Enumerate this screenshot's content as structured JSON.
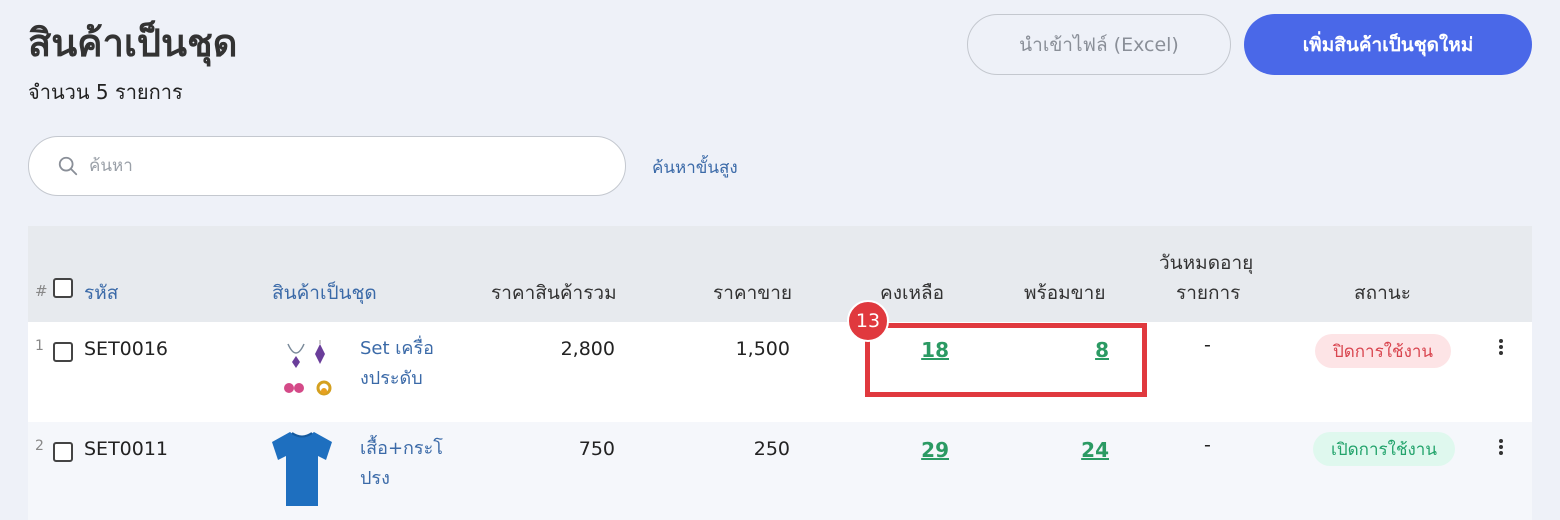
{
  "header": {
    "title": "สินค้าเป็นชุด",
    "count_text": "จำนวน 5 รายการ",
    "import_button": "นำเข้าไฟล์ (Excel)",
    "add_button": "เพิ่มสินค้าเป็นชุดใหม่"
  },
  "search": {
    "placeholder": "ค้นหา",
    "advanced_label": "ค้นหาขั้นสูง"
  },
  "table": {
    "columns": {
      "hash": "#",
      "code": "รหัส",
      "product": "สินค้าเป็นชุด",
      "total_price": "ราคาสินค้ารวม",
      "sell_price": "ราคาขาย",
      "remaining": "คงเหลือ",
      "ready": "พร้อมขาย",
      "expiry_line1": "วันหมดอายุ",
      "expiry_line2": "รายการ",
      "status": "สถานะ"
    },
    "rows": [
      {
        "num": "1",
        "code": "SET0016",
        "name_line1": "Set เครื่อ",
        "name_line2": "งประดับ",
        "total_price": "2,800",
        "sell_price": "1,500",
        "remaining": "18",
        "ready": "8",
        "expiry": "-",
        "status": "ปิดการใช้งาน",
        "thumb_icon": "jewelry-icon"
      },
      {
        "num": "2",
        "code": "SET0011",
        "name_line1": "เสื้อ+กระโ",
        "name_line2": "ปรง",
        "total_price": "750",
        "sell_price": "250",
        "remaining": "29",
        "ready": "24",
        "expiry": "-",
        "status": "เปิดการใช้งาน",
        "thumb_icon": "tshirt-icon"
      }
    ]
  },
  "annotation": {
    "step_number": "13"
  },
  "colors": {
    "primary": "#4a68e8",
    "link": "#3b6aa8",
    "stock_link": "#2b9a63",
    "status_off": "#d9454f",
    "status_on": "#22a36b",
    "highlight": "#e0393e"
  }
}
